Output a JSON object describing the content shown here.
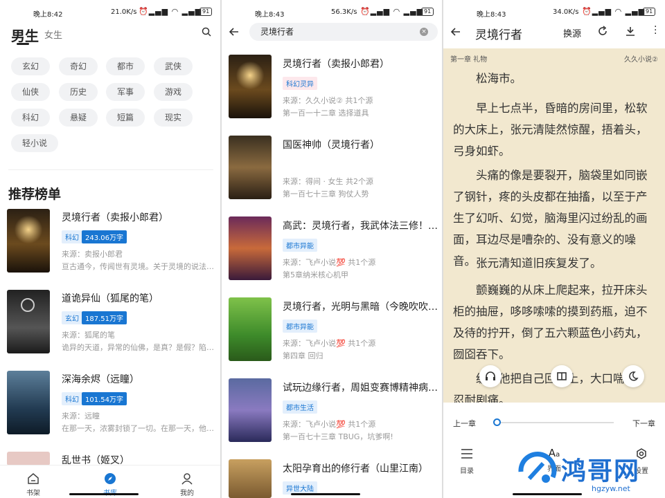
{
  "status": [
    {
      "time": "晚上8:42",
      "speed": "21.0K/s",
      "battery": "91"
    },
    {
      "time": "晚上8:43",
      "speed": "56.3K/s",
      "battery": "91"
    },
    {
      "time": "晚上8:43",
      "speed": "34.0K/s",
      "battery": "91"
    }
  ],
  "library": {
    "tab_male": "男生",
    "tab_female": "女生",
    "tags": [
      "玄幻",
      "奇幻",
      "都市",
      "武侠",
      "仙侠",
      "历史",
      "军事",
      "游戏",
      "科幻",
      "悬疑",
      "短篇",
      "现实",
      "轻小说"
    ],
    "section_title": "推荐榜单",
    "books": [
      {
        "title": "灵境行者（卖报小郎君）",
        "genre": "科幻",
        "count": "243.06万字",
        "source": "来源：卖报小郎君",
        "desc": "亘古通今，传闻世有灵境。关于灵境的说法…"
      },
      {
        "title": "道诡异仙（狐尾的笔）",
        "genre": "玄幻",
        "count": "187.51万字",
        "source": "来源：狐尾的笔",
        "desc": "诡异的天道，异常的仙佛，是真？是假？陷…"
      },
      {
        "title": "深海余烬（远瞳）",
        "genre": "科幻",
        "count": "101.54万字",
        "source": "来源：远瞳",
        "desc": "在那一天，浓雾封锁了一切。在那一天，他…"
      },
      {
        "title": "乱世书（姬叉）"
      }
    ],
    "nav": [
      "书架",
      "书库",
      "我的"
    ]
  },
  "search": {
    "query": "灵境行者",
    "results": [
      {
        "title": "灵境行者（卖报小郎君）",
        "genre": "科幻灵异",
        "source": "来源：久久小说② 共1个源",
        "chapter": "第一百一十二章 选择道具"
      },
      {
        "title": "国医神帅（灵境行者）",
        "genre": "",
        "source": "来源：得间 · 女生 共2个源",
        "chapter": "第一百七十三章 狗仗人势"
      },
      {
        "title": "高武：灵境行者，我武体法三修！(…",
        "genre": "都市异能",
        "source": "来源：飞卢小说💯 共1个源",
        "chapter": "第5章纳米核心机甲"
      },
      {
        "title": "灵境行者，光明与黑暗（今晚吹吹风）",
        "genre": "都市异能",
        "source": "来源：飞卢小说💯 共1个源",
        "chapter": "第四章 回归"
      },
      {
        "title": "试玩边缘行者，周姐变赛博精神病 …",
        "genre": "都市生活",
        "source": "来源：飞卢小说💯 共1个源",
        "chapter": "第一百七十三章 TBUG，坑爹啊!"
      },
      {
        "title": "太阳孕育出的修行者（山里江南）",
        "genre": "异世大陆",
        "source": "",
        "chapter": ""
      }
    ]
  },
  "reader": {
    "title": "灵境行者",
    "change_source": "换源",
    "chapter": "第一章 礼物",
    "source": "久久小说②",
    "paragraphs": [
      "松海市。",
      "早上七点半，昏暗的房间里，松软的大床上，张元清陡然惊醒，捂着头，弓身如虾。",
      "头痛的像是要裂开，脑袋里如同嵌了钢针，疼的头皮都在抽搐，以至于产生了幻听、幻觉，脑海里闪过纷乱的画面，耳边尽是嘈杂的、没有意义的噪音。",
      "张元清知道旧疾复发了。",
      "颤巍巍的从床上爬起来，拉开床头柜的抽屉，哆哆嗦嗦的摸到药瓶，迫不及待的拧开，倒了五六颗蓝色小药丸，囫囵吞下。",
      "缓，他把自己回床上，大口喘息，忍耐剧痛。"
    ],
    "prev": "上一章",
    "next": "下一章",
    "progress": 0.0,
    "bottom": [
      "目录",
      "界面",
      "设置"
    ]
  },
  "watermark": {
    "text": "鸿哥网",
    "url": "hgzyw.net"
  },
  "colors": {
    "accent": "#1976d2",
    "badge_bg": "#e3effc",
    "badge_red": "#fde8ec",
    "reader_bg": "#f2e8cf"
  }
}
